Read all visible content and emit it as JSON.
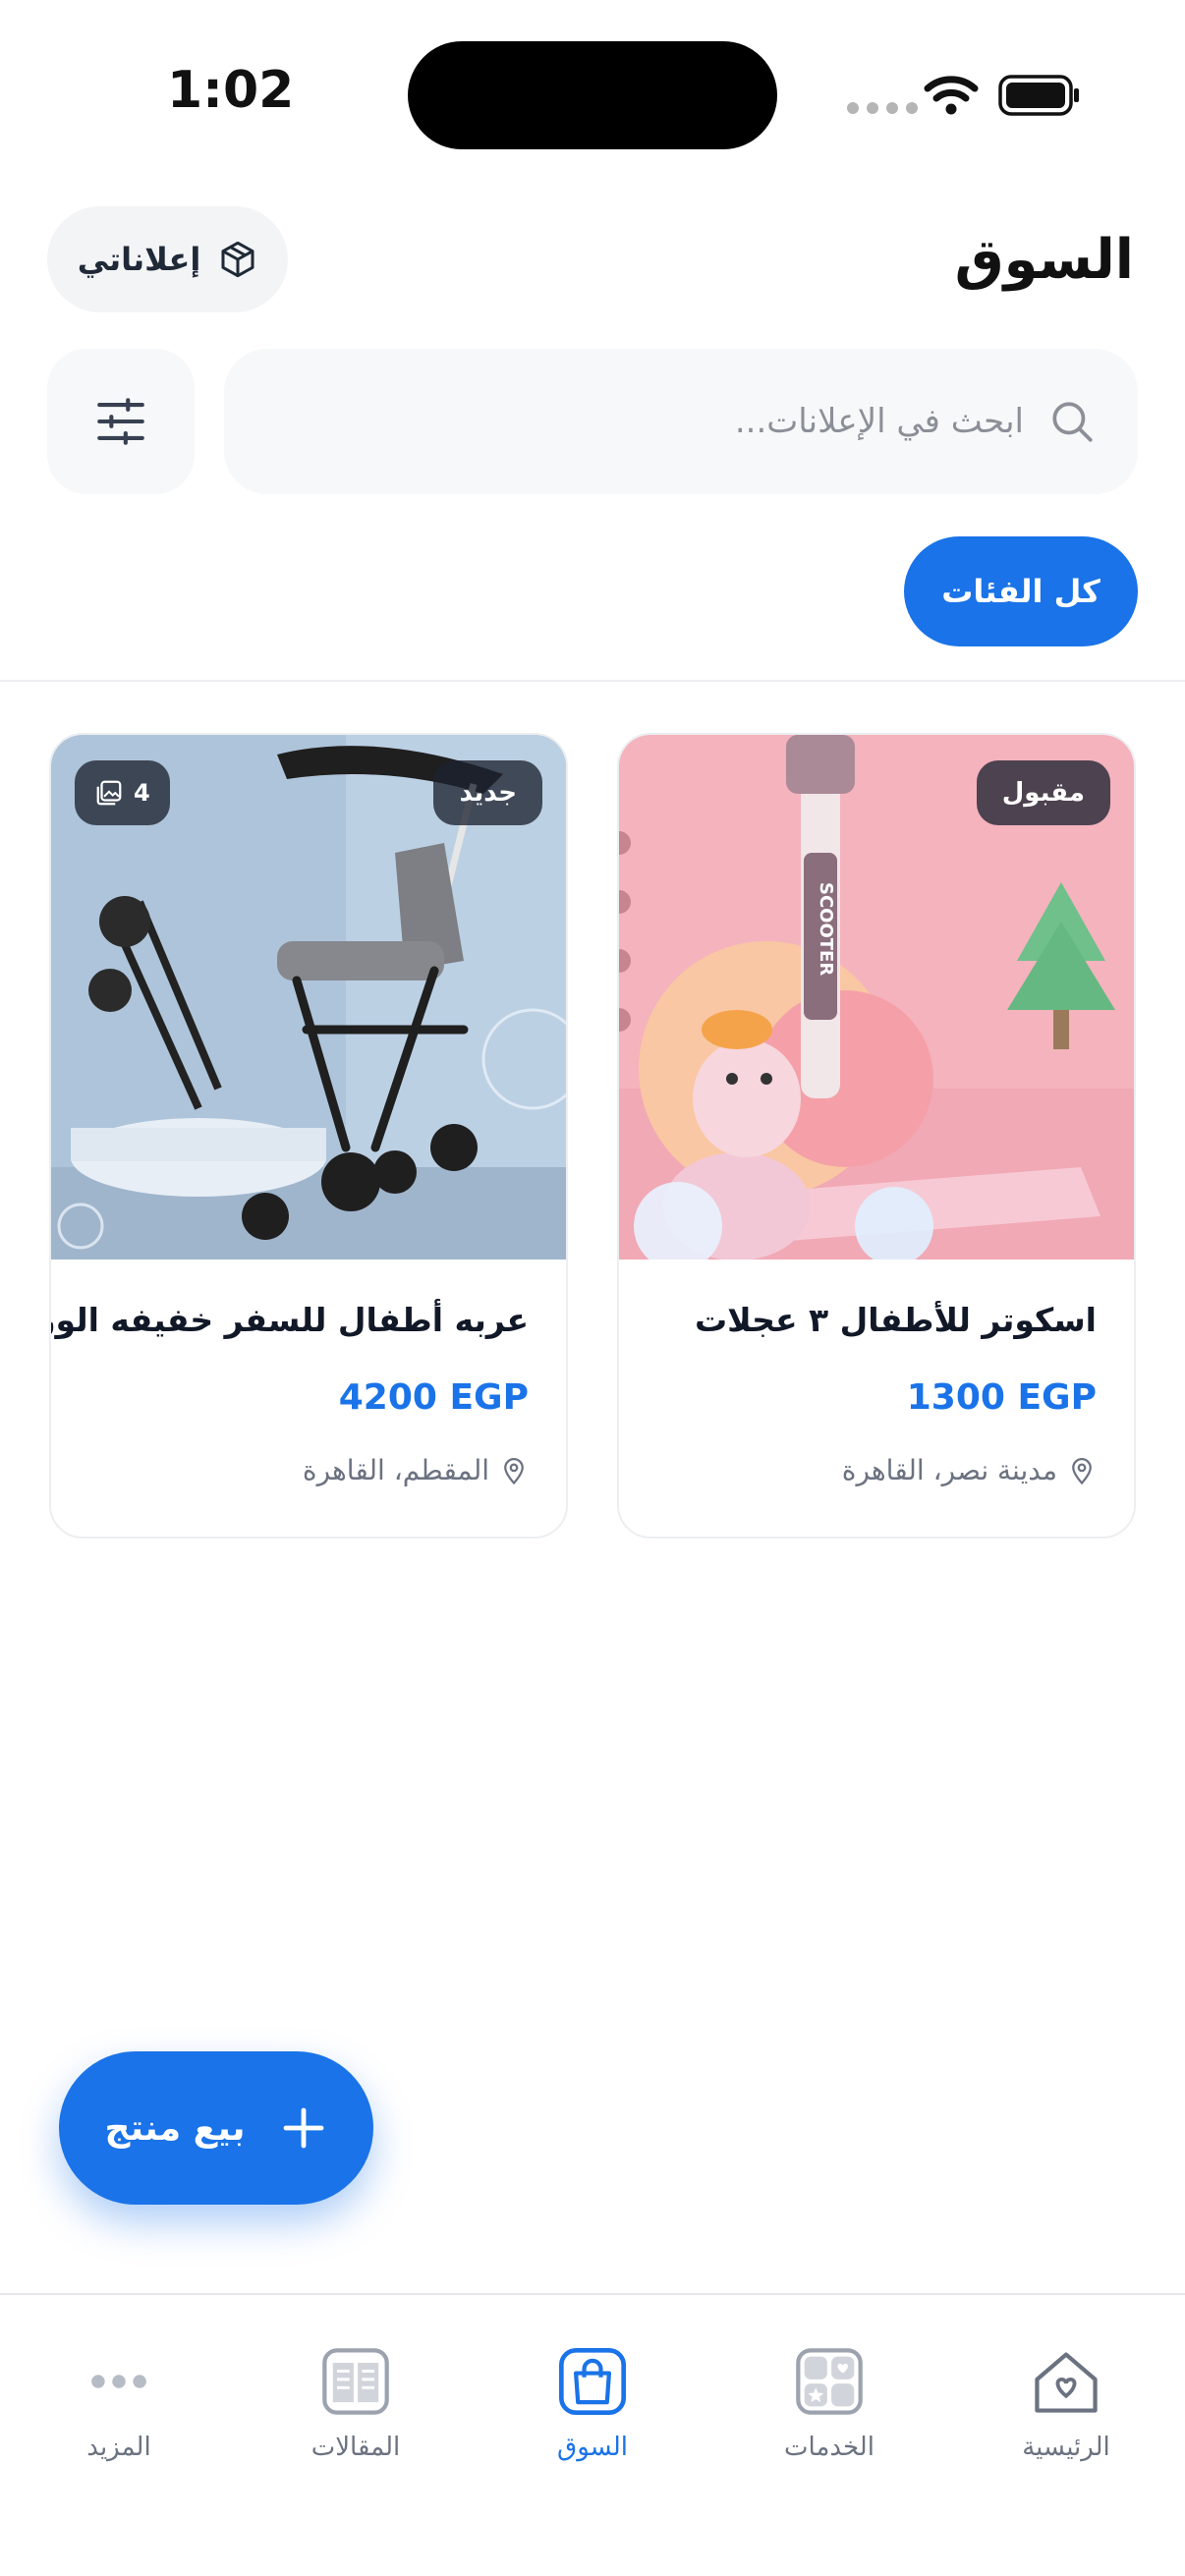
{
  "status_bar": {
    "time": "1:02"
  },
  "header": {
    "title": "السوق",
    "my_ads_label": "إعلاناتي"
  },
  "search": {
    "placeholder": "ابحث في الإعلانات..."
  },
  "filters": {
    "all_categories_label": "كل الفئات"
  },
  "listings": [
    {
      "title": "اسكوتر للأطفال ٣ عجلات",
      "price": "1300 EGP",
      "location": "مدينة نصر، القاهرة",
      "badge": "مقبول",
      "image_subject": "kids scooter"
    },
    {
      "title": "عربه أطفال للسفر خفيفه الوزن",
      "price": "4200 EGP",
      "location": "المقطم، القاهرة",
      "badge": "جديد",
      "image_count": "4",
      "image_subject": "travel stroller"
    }
  ],
  "fab": {
    "label": "بيع منتج"
  },
  "bottom_nav": [
    {
      "label": "الرئيسية",
      "icon": "home-icon",
      "active": false
    },
    {
      "label": "الخدمات",
      "icon": "services-icon",
      "active": false
    },
    {
      "label": "السوق",
      "icon": "shopping-bag-icon",
      "active": true
    },
    {
      "label": "المقالات",
      "icon": "articles-icon",
      "active": false
    },
    {
      "label": "المزيد",
      "icon": "more-icon",
      "active": false
    }
  ],
  "colors": {
    "accent": "#1a73e8",
    "text": "#111827",
    "muted": "#6b7280"
  }
}
